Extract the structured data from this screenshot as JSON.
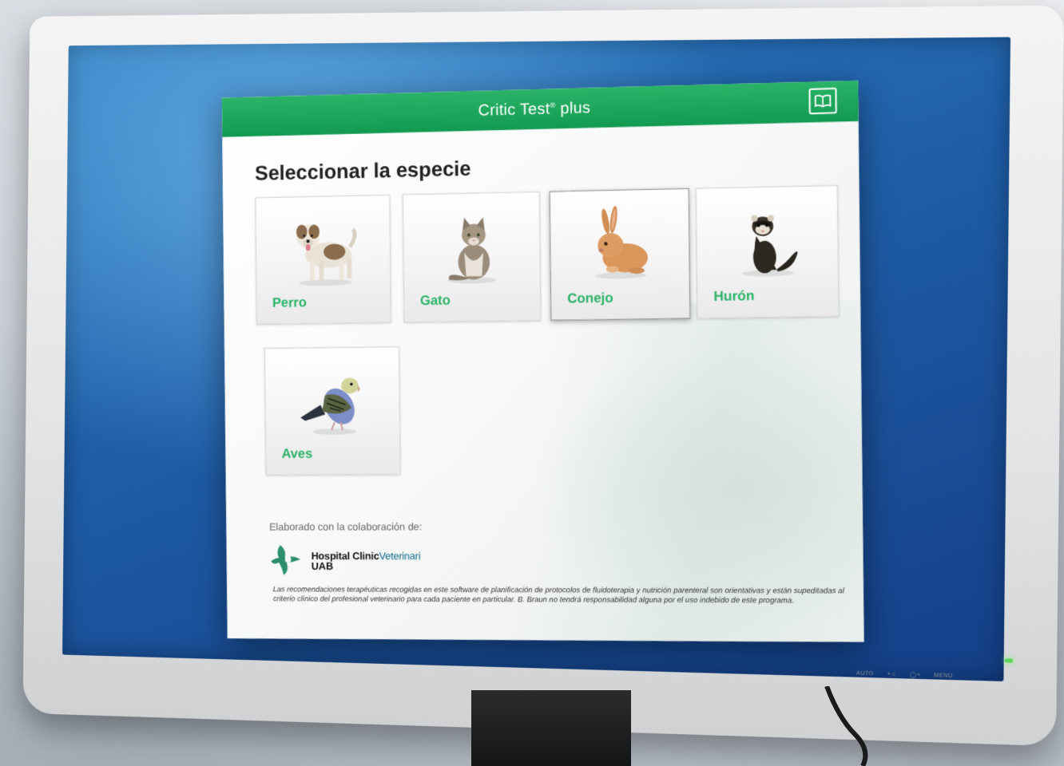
{
  "app": {
    "title_main": "Critic Test",
    "title_reg": "®",
    "title_suffix": " plus",
    "help_icon": "book-icon"
  },
  "page": {
    "heading": "Seleccionar la especie"
  },
  "species": [
    {
      "label": "Perro",
      "icon": "dog-icon",
      "selected": false
    },
    {
      "label": "Gato",
      "icon": "cat-icon",
      "selected": false
    },
    {
      "label": "Conejo",
      "icon": "rabbit-icon",
      "selected": true
    },
    {
      "label": "Hurón",
      "icon": "ferret-icon",
      "selected": false
    },
    {
      "label": "Aves",
      "icon": "bird-icon",
      "selected": false
    }
  ],
  "footer": {
    "collab_heading": "Elaborado con la colaboración de:",
    "logo_text_1": "Hospital Clinic",
    "logo_text_1b": "Veterinari",
    "logo_text_2": "UAB",
    "disclaimer": "Las recomendaciones terapéuticas recogidas en este software de planificación de protocolos de fluidoterapia y nutrición parenteral son orientativas y están supeditadas al criterio clínico del profesional veterinario para cada paciente en particular. B. Braun no tendrá responsabilidad alguna por el uso indebido de este programa."
  },
  "monitor": {
    "controls": [
      "AUTO",
      "+☼",
      "◯+",
      "MENU"
    ]
  },
  "colors": {
    "accent_green": "#2bb368",
    "titlebar_dark_green": "#129a52",
    "screen_blue": "#1f5ea8"
  }
}
